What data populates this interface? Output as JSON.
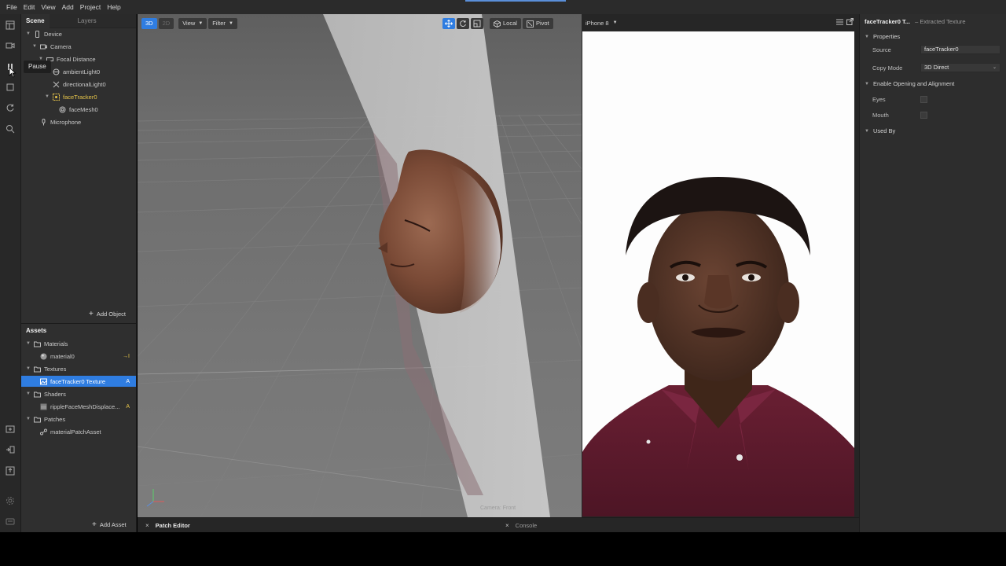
{
  "menubar": {
    "items": [
      "File",
      "Edit",
      "View",
      "Add",
      "Project",
      "Help"
    ]
  },
  "tooltip": {
    "text": "Pause"
  },
  "scene_panel": {
    "tabs": [
      "Scene",
      "Layers"
    ],
    "tree": [
      {
        "label": "Device",
        "icon": "phone-icon"
      },
      {
        "label": "Camera",
        "icon": "camera-icon"
      },
      {
        "label": "Focal Distance",
        "icon": "focal-distance-icon"
      },
      {
        "label": "ambientLight0",
        "icon": "ambient-light-icon"
      },
      {
        "label": "directionalLight0",
        "icon": "directional-light-icon"
      },
      {
        "label": "faceTracker0",
        "icon": "face-tracker-icon"
      },
      {
        "label": "faceMesh0",
        "icon": "face-mesh-icon"
      },
      {
        "label": "Microphone",
        "icon": "microphone-icon"
      }
    ],
    "add_object_label": "Add Object"
  },
  "assets_panel": {
    "title": "Assets",
    "tree": [
      {
        "label": "Materials",
        "icon": "folder-icon"
      },
      {
        "label": "material0",
        "icon": "material-sphere-icon",
        "badge": "→I"
      },
      {
        "label": "Textures",
        "icon": "folder-icon"
      },
      {
        "label": "faceTracker0 Texture",
        "icon": "texture-icon",
        "badge": "A"
      },
      {
        "label": "Shaders",
        "icon": "folder-icon"
      },
      {
        "label": "rippleFaceMeshDisplace...",
        "icon": "shader-icon",
        "badge": "A"
      },
      {
        "label": "Patches",
        "icon": "folder-icon"
      },
      {
        "label": "materialPatchAsset",
        "icon": "patch-icon"
      }
    ],
    "add_asset_label": "Add Asset"
  },
  "viewport": {
    "mode_3d": "3D",
    "mode_2d": "2D",
    "view_label": "View",
    "filter_label": "Filter",
    "local_label": "Local",
    "pivot_label": "Pivot",
    "camera_label": "Camera: Front"
  },
  "bottom_bar": {
    "patch_editor_label": "Patch Editor",
    "console_label": "Console"
  },
  "preview": {
    "device_label": "iPhone 8"
  },
  "inspector": {
    "title": "faceTracker0 T...",
    "subtitle": "– Extracted Texture",
    "properties_label": "Properties",
    "source_label": "Source",
    "source_value": "faceTracker0",
    "copy_mode_label": "Copy Mode",
    "copy_mode_value": "3D Direct",
    "enable_section_label": "Enable Opening and Alignment",
    "eyes_label": "Eyes",
    "mouth_label": "Mouth",
    "used_by_label": "Used By"
  },
  "colors": {
    "accent": "#2f7de1",
    "highlight_yellow": "#e8c64a",
    "panel_bg": "#2f2f2f",
    "viewport_bg": "#707070"
  }
}
